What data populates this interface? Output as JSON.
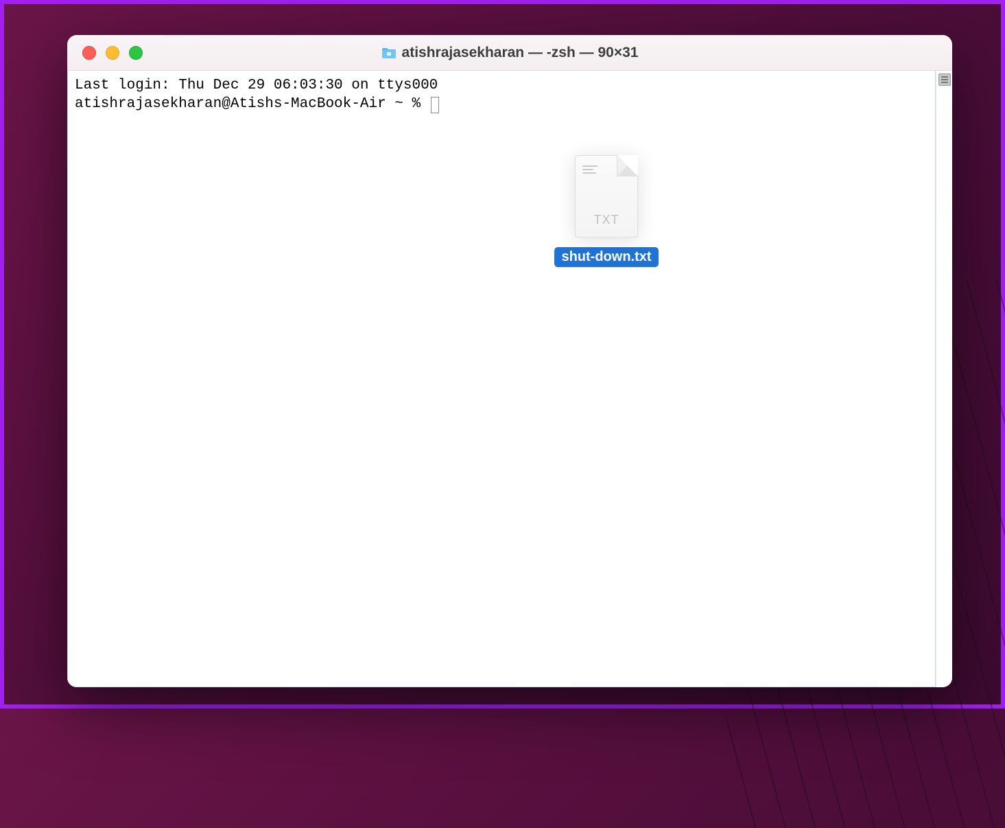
{
  "window": {
    "title": "atishrajasekharan — -zsh — 90×31"
  },
  "terminal": {
    "last_login": "Last login: Thu Dec 29 06:03:30 on ttys000",
    "prompt": "atishrajasekharan@Atishs-MacBook-Air ~ % "
  },
  "dragged_file": {
    "name": "shut-down.txt",
    "ext_label": "TXT"
  },
  "colors": {
    "selection_blue": "#1e74d6",
    "accent_purple": "#a020f0"
  }
}
